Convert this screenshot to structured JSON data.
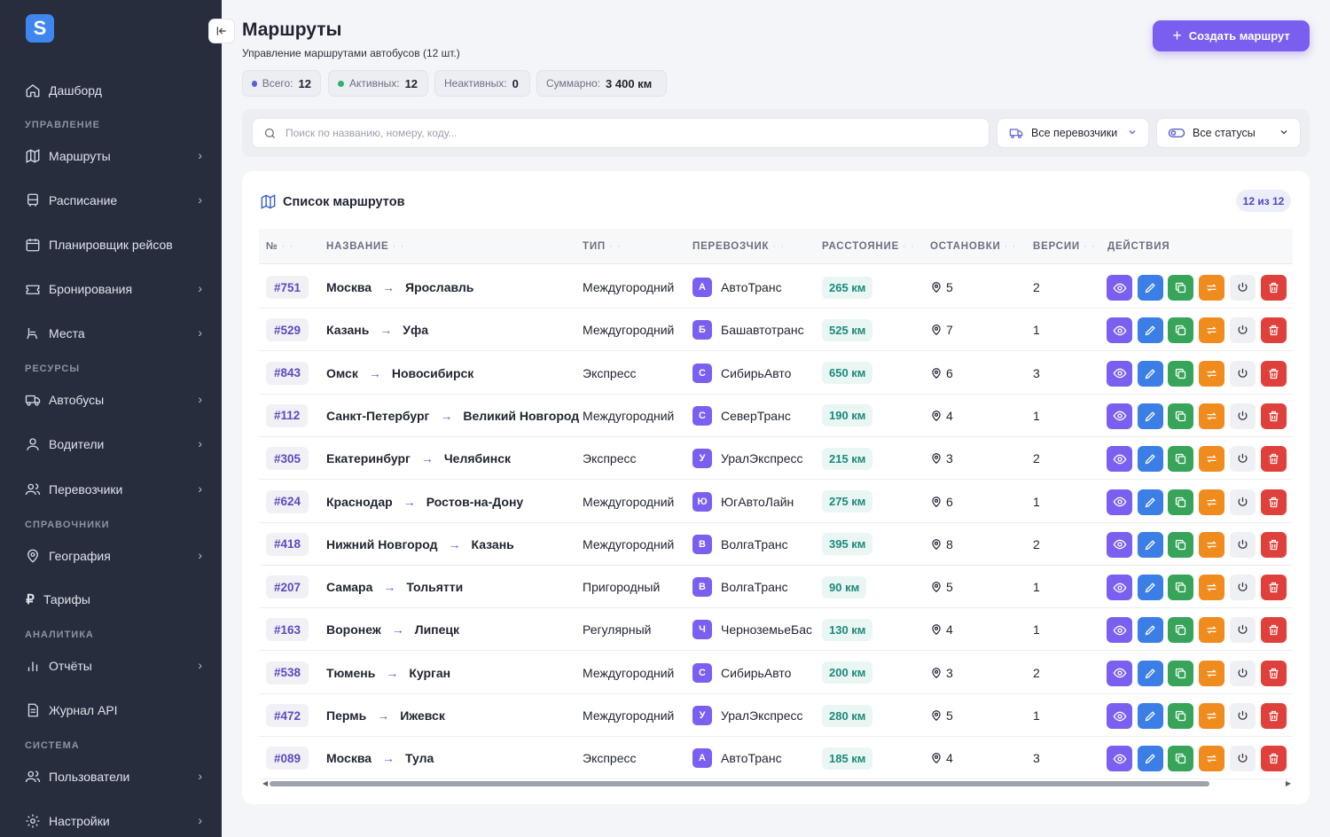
{
  "app": {
    "logo_letter": "S",
    "brand_color": "#7a5ef0"
  },
  "sidebar": {
    "items": [
      {
        "label": "Дашборд",
        "icon": "home-icon"
      },
      {
        "label": "Маршруты",
        "icon": "map-icon"
      },
      {
        "label": "Расписание",
        "icon": "bus-icon"
      },
      {
        "label": "Планировщик рейсов",
        "icon": "calendar-icon"
      },
      {
        "label": "Бронирования",
        "icon": "ticket-icon"
      },
      {
        "label": "Места",
        "icon": "seat-icon"
      },
      {
        "label": "Автобусы",
        "icon": "truck-icon"
      },
      {
        "label": "Водители",
        "icon": "user-icon"
      },
      {
        "label": "Перевозчики",
        "icon": "users-icon"
      },
      {
        "label": "География",
        "icon": "map-pin-icon"
      },
      {
        "label": "Тарифы",
        "icon": "ruble-icon"
      },
      {
        "label": "Отчёты",
        "icon": "bar-chart-icon"
      },
      {
        "label": "Журнал API",
        "icon": "document-icon"
      },
      {
        "label": "Пользователи",
        "icon": "users-icon"
      },
      {
        "label": "Настройки",
        "icon": "gear-icon"
      }
    ],
    "sections": [
      "УПРАВЛЕНИЕ",
      "РЕСУРСЫ",
      "СПРАВОЧНИКИ",
      "АНАЛИТИКА",
      "СИСТЕМА"
    ]
  },
  "header": {
    "title": "Маршруты",
    "subtitle": "Управление маршрутами автобусов (12 шт.)",
    "create_label": "Создать маршрут"
  },
  "stats": [
    {
      "label": "Всего:",
      "value": "12",
      "dot": "#5b5fd0"
    },
    {
      "label": "Активных:",
      "value": "12",
      "dot": "#2fb36b"
    },
    {
      "label": "Неактивных:",
      "value": "0"
    },
    {
      "label": "Суммарно:",
      "value": "3 400 км"
    }
  ],
  "filters": {
    "search_placeholder": "Поиск по названию, номеру, коду...",
    "carrier": "Все перевозчики",
    "status": "Все статусы"
  },
  "table": {
    "title": "Список маршрутов",
    "count": "12 из 12",
    "columns": [
      "№",
      "НАЗВАНИЕ",
      "ТИП",
      "ПЕРЕВОЗЧИК",
      "РАССТОЯНИЕ",
      "ОСТАНОВКИ",
      "ВЕРСИИ",
      "ДЕЙСТВИЯ"
    ],
    "rows": [
      {
        "num": "#751",
        "from": "Москва",
        "to": "Ярославль",
        "type": "Междугородний",
        "carrier_initial": "А",
        "carrier": "АвтоТранс",
        "distance": "265 км",
        "stops": "5",
        "versions": "2"
      },
      {
        "num": "#529",
        "from": "Казань",
        "to": "Уфа",
        "type": "Междугородний",
        "carrier_initial": "Б",
        "carrier": "Башавтотранс",
        "distance": "525 км",
        "stops": "7",
        "versions": "1"
      },
      {
        "num": "#843",
        "from": "Омск",
        "to": "Новосибирск",
        "type": "Экспресс",
        "carrier_initial": "С",
        "carrier": "СибирьАвто",
        "distance": "650 км",
        "stops": "6",
        "versions": "3"
      },
      {
        "num": "#112",
        "from": "Санкт-Петербург",
        "to": "Великий Новгород",
        "type": "Междугородний",
        "carrier_initial": "С",
        "carrier": "СеверТранс",
        "distance": "190 км",
        "stops": "4",
        "versions": "1"
      },
      {
        "num": "#305",
        "from": "Екатеринбург",
        "to": "Челябинск",
        "type": "Экспресс",
        "carrier_initial": "У",
        "carrier": "УралЭкспресс",
        "distance": "215 км",
        "stops": "3",
        "versions": "2"
      },
      {
        "num": "#624",
        "from": "Краснодар",
        "to": "Ростов-на-Дону",
        "type": "Междугородний",
        "carrier_initial": "Ю",
        "carrier": "ЮгАвтоЛайн",
        "distance": "275 км",
        "stops": "6",
        "versions": "1"
      },
      {
        "num": "#418",
        "from": "Нижний Новгород",
        "to": "Казань",
        "type": "Междугородний",
        "carrier_initial": "В",
        "carrier": "ВолгаТранс",
        "distance": "395 км",
        "stops": "8",
        "versions": "2"
      },
      {
        "num": "#207",
        "from": "Самара",
        "to": "Тольятти",
        "type": "Пригородный",
        "carrier_initial": "В",
        "carrier": "ВолгаТранс",
        "distance": "90 км",
        "stops": "5",
        "versions": "1"
      },
      {
        "num": "#163",
        "from": "Воронеж",
        "to": "Липецк",
        "type": "Регулярный",
        "carrier_initial": "Ч",
        "carrier": "ЧерноземьеБас",
        "distance": "130 км",
        "stops": "4",
        "versions": "1"
      },
      {
        "num": "#538",
        "from": "Тюмень",
        "to": "Курган",
        "type": "Междугородний",
        "carrier_initial": "С",
        "carrier": "СибирьАвто",
        "distance": "200 км",
        "stops": "3",
        "versions": "2"
      },
      {
        "num": "#472",
        "from": "Пермь",
        "to": "Ижевск",
        "type": "Междугородний",
        "carrier_initial": "У",
        "carrier": "УралЭкспресс",
        "distance": "280 км",
        "stops": "5",
        "versions": "1"
      },
      {
        "num": "#089",
        "from": "Москва",
        "to": "Тула",
        "type": "Экспресс",
        "carrier_initial": "А",
        "carrier": "АвтоТранс",
        "distance": "185 км",
        "stops": "4",
        "versions": "3"
      }
    ],
    "actions": [
      "view-icon",
      "edit-icon",
      "copy-icon",
      "swap-icon",
      "power-icon",
      "trash-icon"
    ]
  }
}
